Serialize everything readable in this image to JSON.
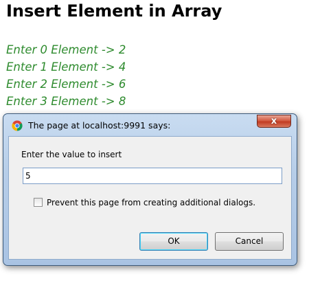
{
  "page": {
    "title": "Insert Element in Array",
    "element_lines": [
      "Enter 0 Element -> 2",
      "Enter 1 Element -> 4",
      "Enter 2 Element -> 6",
      "Enter 3 Element -> 8"
    ]
  },
  "dialog": {
    "title": "The page at localhost:9991 says:",
    "title_icon": "chrome-icon",
    "close_icon": "close-icon",
    "close_glyph": "x",
    "prompt": "Enter the value to insert",
    "input_value": "5",
    "checkbox_label": "Prevent this page from creating additional dialogs.",
    "checkbox_checked": false,
    "ok_label": "OK",
    "cancel_label": "Cancel"
  },
  "colors": {
    "element_text": "#2e8b2e",
    "dialog_frame": "#b6cde8",
    "close_button": "#c23b22"
  }
}
